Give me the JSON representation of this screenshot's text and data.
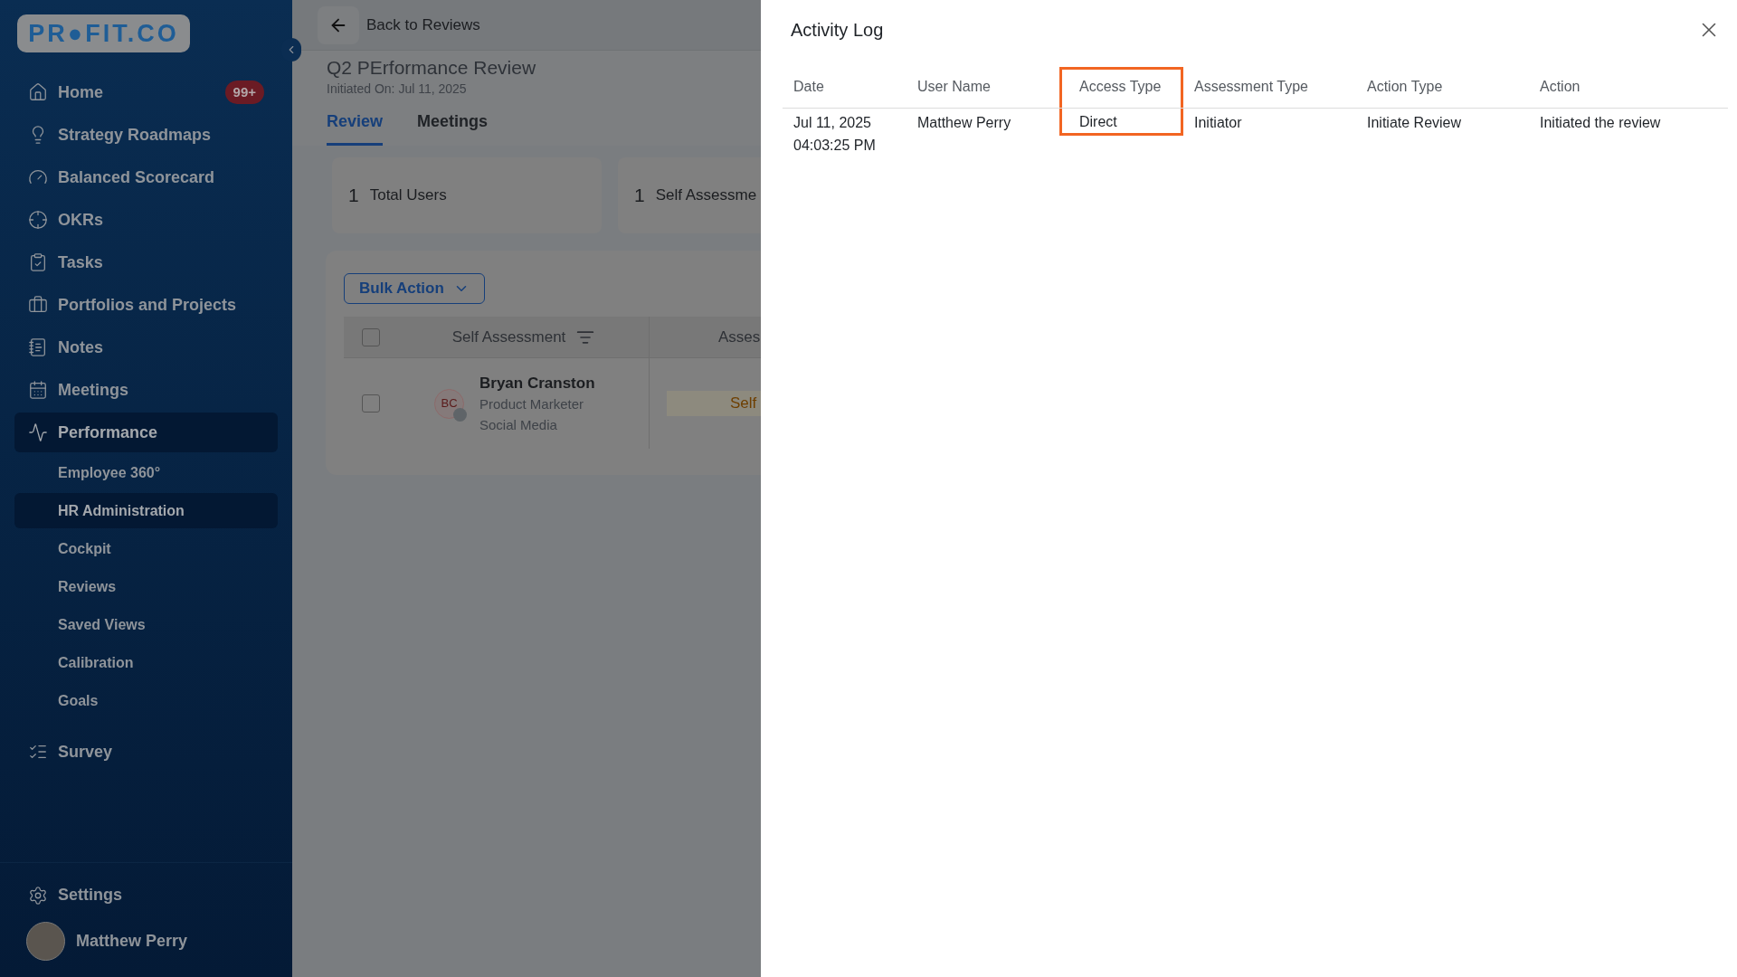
{
  "sidebar": {
    "logo": "PR●FIT.CO",
    "items": [
      {
        "label": "Home",
        "badge": "99+",
        "selected": false
      },
      {
        "label": "Strategy Roadmaps",
        "selected": false
      },
      {
        "label": "Balanced Scorecard",
        "selected": false
      },
      {
        "label": "OKRs",
        "selected": false
      },
      {
        "label": "Tasks",
        "selected": false
      },
      {
        "label": "Portfolios and Projects",
        "selected": false
      },
      {
        "label": "Notes",
        "selected": false
      },
      {
        "label": "Meetings",
        "selected": false
      },
      {
        "label": "Performance",
        "selected": true,
        "expanded": true,
        "children": [
          {
            "label": "Employee 360°",
            "selected": false
          },
          {
            "label": "HR Administration",
            "selected": true
          },
          {
            "label": "Cockpit",
            "selected": false
          },
          {
            "label": "Reviews",
            "selected": false
          },
          {
            "label": "Saved Views",
            "selected": false
          },
          {
            "label": "Calibration",
            "selected": false
          },
          {
            "label": "Goals",
            "selected": false
          }
        ]
      },
      {
        "label": "Survey",
        "selected": false
      }
    ],
    "settings": "Settings",
    "user": "Matthew Perry"
  },
  "main": {
    "back": "Back to Reviews",
    "title": "Q2 PErformance Review",
    "subtitle": "Initiated On: Jul 11, 2025",
    "tabs": [
      {
        "label": "Review",
        "selected": true
      },
      {
        "label": "Meetings",
        "selected": false
      }
    ],
    "stats": [
      {
        "value": "1",
        "label": "Total Users"
      },
      {
        "value": "1",
        "label": "Self Assessme"
      }
    ],
    "bulk_action": "Bulk Action",
    "table": {
      "columns": [
        "Self Assessment",
        "Asses"
      ],
      "header_checked": false,
      "rows": [
        {
          "checked": false,
          "initials": "BC",
          "name": "Bryan Cranston",
          "role": "Product Marketer",
          "team": "Social Media",
          "status": "Self"
        }
      ]
    }
  },
  "activity_log": {
    "title": "Activity Log",
    "columns": [
      {
        "label": "Date",
        "highlighted": false
      },
      {
        "label": "User Name",
        "highlighted": false
      },
      {
        "label": "Access Type",
        "highlighted": true
      },
      {
        "label": "Assessment Type",
        "highlighted": false
      },
      {
        "label": "Action Type",
        "highlighted": false
      },
      {
        "label": "Action",
        "highlighted": false
      }
    ],
    "rows": [
      {
        "cells": [
          "Jul 11, 2025\n04:03:25 PM",
          "Matthew Perry",
          "Direct",
          "Initiator",
          "Initiate Review",
          "Initiated the review"
        ]
      }
    ]
  }
}
